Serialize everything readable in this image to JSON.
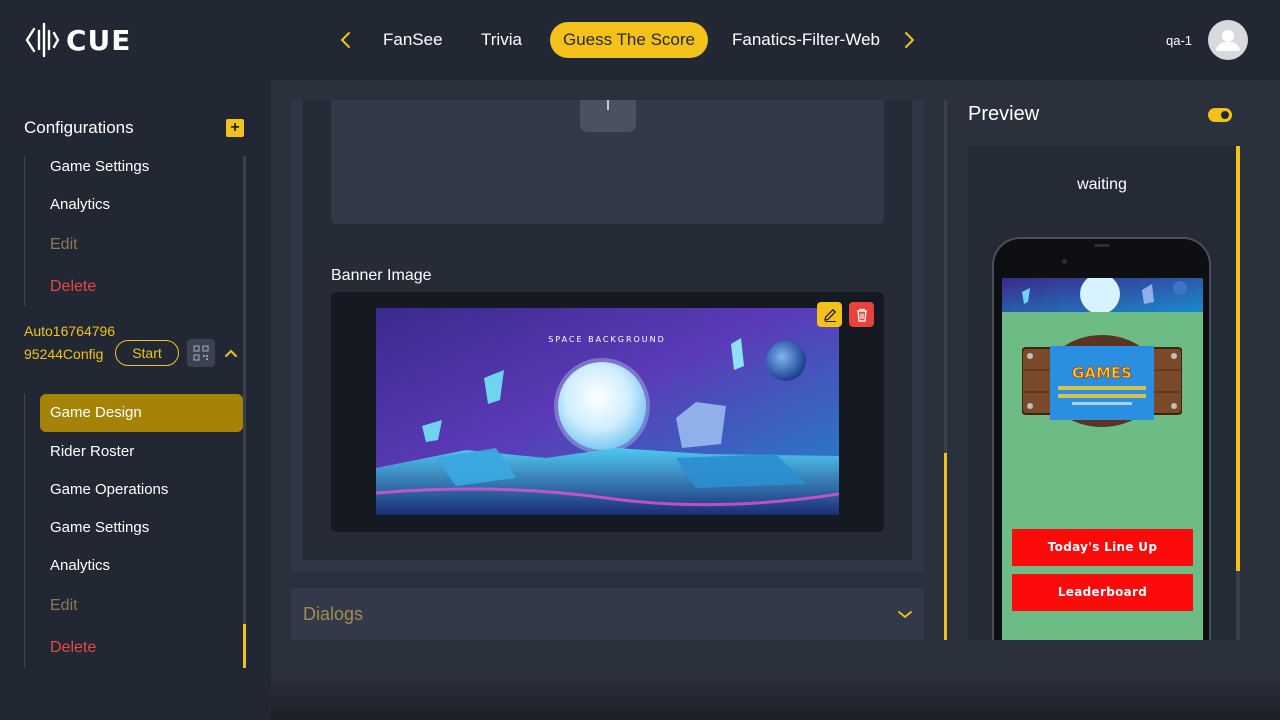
{
  "app": {
    "logo_text": "CUE"
  },
  "nav": {
    "items": [
      {
        "label": "FanSee"
      },
      {
        "label": "Trivia"
      },
      {
        "label": "Guess The Score",
        "active": true
      },
      {
        "label": "Fanatics-Filter-Web"
      }
    ]
  },
  "user": {
    "name": "qa-1"
  },
  "sidebar": {
    "title": "Configurations",
    "group1": [
      {
        "label": "Game Settings"
      },
      {
        "label": "Analytics"
      },
      {
        "label": "Edit"
      },
      {
        "label": "Delete"
      }
    ],
    "config_name": "Auto1676479695244Config",
    "start_label": "Start",
    "group2": [
      {
        "label": "Game Design",
        "active": true
      },
      {
        "label": "Rider Roster"
      },
      {
        "label": "Game Operations"
      },
      {
        "label": "Game Settings"
      },
      {
        "label": "Analytics"
      },
      {
        "label": "Edit"
      },
      {
        "label": "Delete"
      }
    ]
  },
  "main": {
    "banner_label": "Banner Image",
    "banner_image_text": "SPACE BACKGROUND",
    "dialogs_label": "Dialogs"
  },
  "preview": {
    "title": "Preview",
    "status": "waiting",
    "logo_text": "GAMES",
    "buttons": [
      {
        "label": "Today's Line Up"
      },
      {
        "label": "Leaderboard"
      }
    ]
  },
  "colors": {
    "accent": "#f2c21a",
    "danger": "#e74747",
    "sidebar_bg": "#222833",
    "active_item": "#a48306",
    "phone_bg": "#6dbb85",
    "phone_button": "#ff0a0a"
  },
  "icons": [
    "cue-logo-icon",
    "chevron-left-icon",
    "chevron-right-icon",
    "user-avatar-icon",
    "plus-icon",
    "qr-code-icon",
    "chevron-up-icon",
    "pencil-icon",
    "trash-icon",
    "chevron-down-icon"
  ]
}
